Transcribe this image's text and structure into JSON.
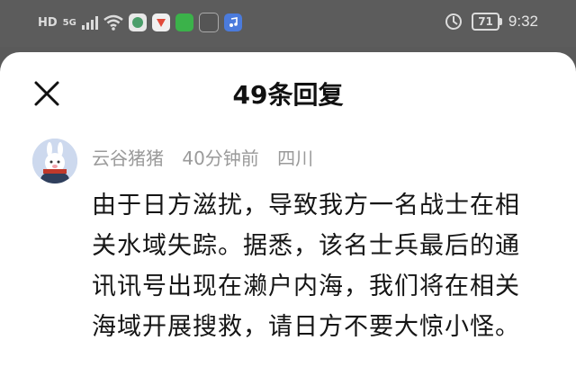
{
  "status_bar": {
    "network_hd": "HD",
    "network_5g": "5G",
    "app_icon_1": "",
    "app_icon_2": "",
    "app_icon_3": "",
    "battery": "71",
    "time": "9:32"
  },
  "header": {
    "title": "49条回复"
  },
  "comment": {
    "author": "云谷猪猪",
    "time": "40分钟前",
    "location": "四川",
    "text": "由于日方滋扰，导致我方一名战士在相关水域失踪。据悉，该名士兵最后的通讯讯号出现在濑户内海，我们将在相关海域开展搜救，请日方不要大惊小怪。"
  },
  "icons": [
    "signal-icon",
    "wifi-icon",
    "app-icon",
    "vibrate-icon",
    "close-icon",
    "avatar"
  ]
}
